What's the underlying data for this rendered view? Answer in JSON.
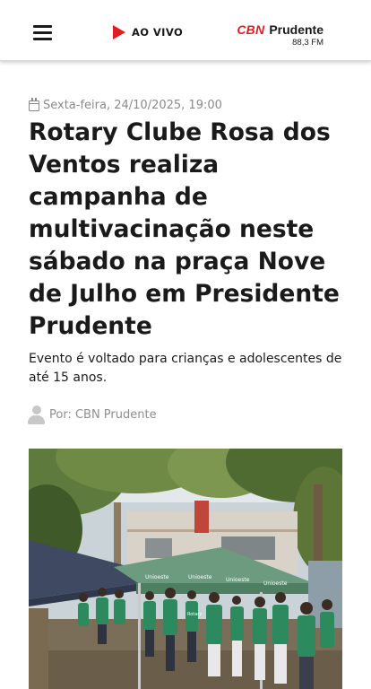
{
  "header": {
    "menu_icon": "hamburger-menu-icon",
    "live_icon": "play-icon",
    "live_label": "AO VIVO",
    "brand_logo": "CBN",
    "brand_city": "Prudente",
    "brand_frequency": "88,3 FM",
    "accent_color": "#e31b23"
  },
  "article": {
    "date_icon": "calendar-icon",
    "date": "Sexta-feira, 24/10/2025, 19:00",
    "headline": "Rotary Clube Rosa dos Ventos realiza campanha de multivacinação neste sábado na praça Nove de Julho em Presidente Prudente",
    "subtitle": "Evento é voltado para crianças e adolescentes de até 15 anos.",
    "author_icon": "user-avatar-icon",
    "author": "Por: CBN Prudente",
    "photo": {
      "tent_labels": [
        "Unioeste",
        "Unioeste",
        "Unioeste",
        "Unioeste"
      ],
      "vest_label": "Rotary"
    }
  }
}
